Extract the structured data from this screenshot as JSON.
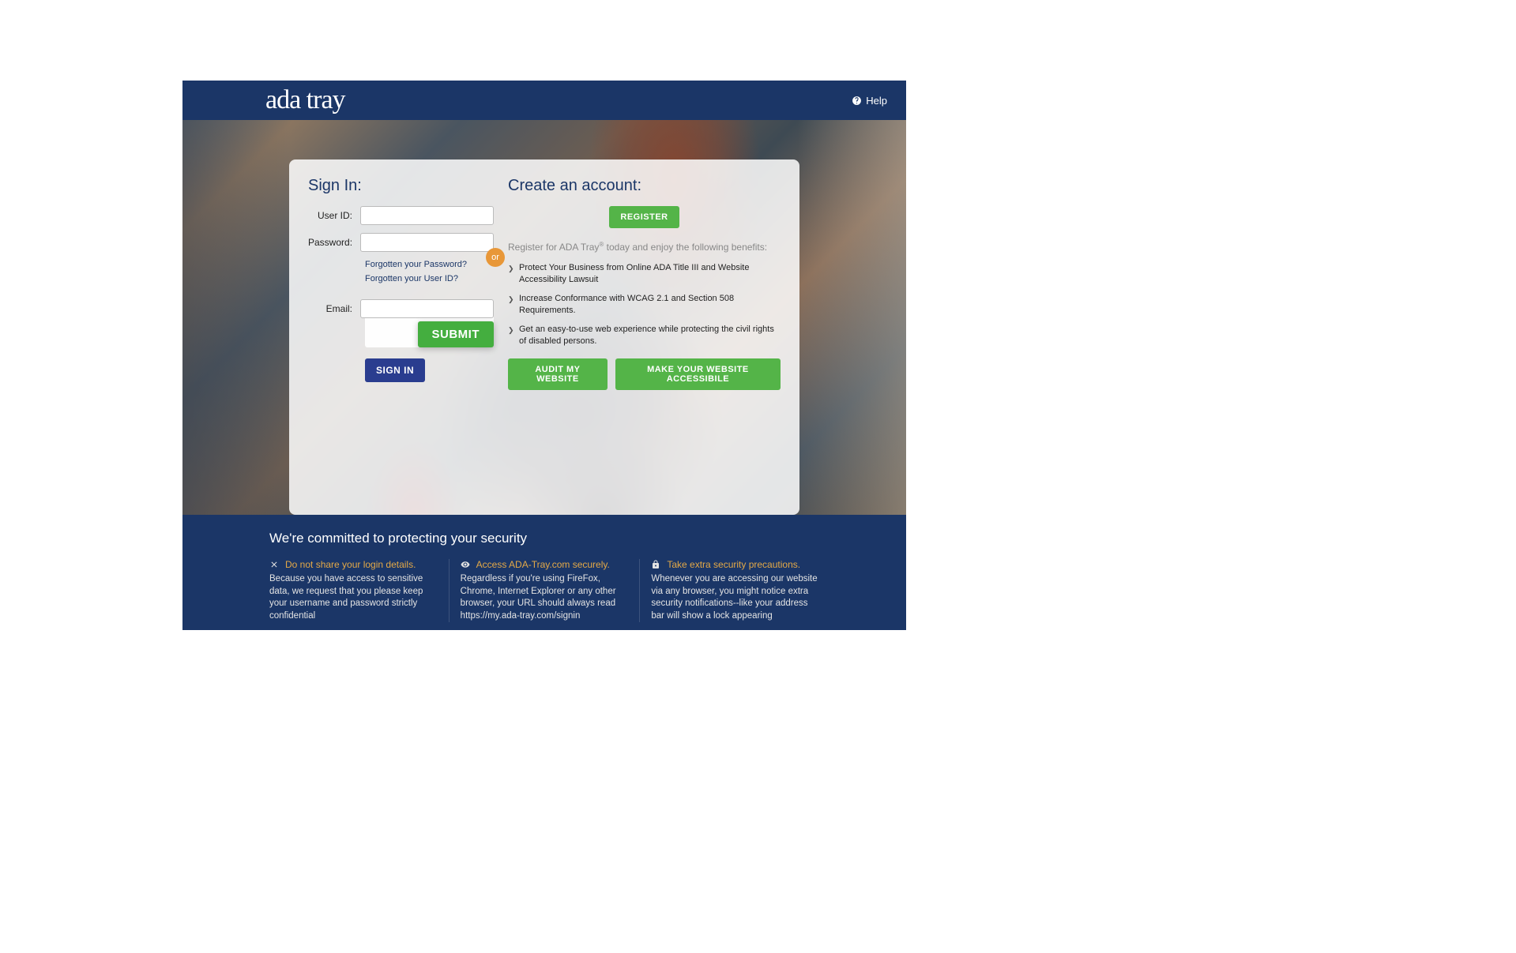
{
  "header": {
    "logo_text": "ada tray",
    "help_label": "Help"
  },
  "signin": {
    "title": "Sign In:",
    "user_id_label": "User ID:",
    "password_label": "Password:",
    "forgot_password": "Forgotten your Password?",
    "forgot_userid": "Forgotten your User ID?",
    "email_label": "Email:",
    "submit_button": "SUBMIT",
    "signin_button": "SIGN IN"
  },
  "or_badge": "or",
  "register": {
    "title": "Create an account:",
    "register_button": "REGISTER",
    "desc_prefix": "Register for ADA Tray",
    "desc_suffix": " today and enjoy the following benefits:",
    "benefits": [
      "Protect Your Business from Online ADA Title III and Website Accessibility Lawsuit",
      "Increase Conformance with WCAG 2.1 and Section 508 Requirements.",
      "Get an easy-to-use web experience while protecting the civil rights of disabled persons."
    ],
    "audit_button": "AUDIT MY WEBSITE",
    "accessible_button": "MAKE YOUR WEBSITE ACCESSIBILE"
  },
  "security": {
    "title": "We're committed to protecting your security",
    "cols": [
      {
        "heading": "Do not share your login details.",
        "body": "Because you have access to sensitive data, we request that you please keep your username and password strictly confidential"
      },
      {
        "heading": "Access ADA-Tray.com securely.",
        "body": "Regardless if you're using FireFox, Chrome, Internet Explorer or any other browser, your URL should always read https://my.ada-tray.com/signin"
      },
      {
        "heading": "Take extra security precautions.",
        "body": "Whenever you are accessing our website via any browser, you might notice extra security notifications--like your address bar will show a lock appearing"
      }
    ]
  }
}
